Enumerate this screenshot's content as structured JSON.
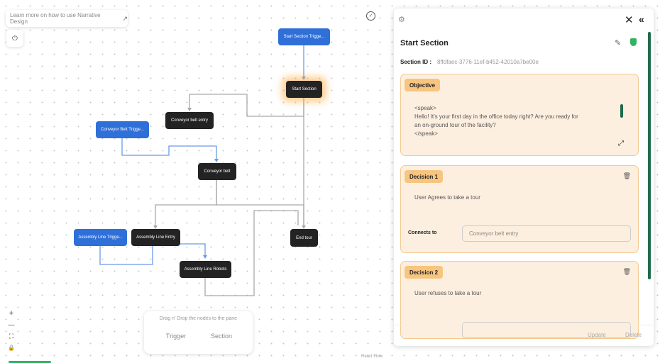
{
  "canvas": {
    "learn_link": "Learn more on how to use Narrative Design",
    "learn_arrow": "↗",
    "power_icon": "⏻",
    "check_icon": "✓",
    "zoom_in": "+",
    "zoom_out": "—",
    "fit": "⛶",
    "lock": "🔒",
    "drag_hint": "Drag n' Drop the nodes to the pane",
    "trigger_label": "Trigger",
    "section_label": "Section",
    "reactflow_label": "React Flow"
  },
  "nodes": [
    {
      "label": "Start Section Trigge...",
      "style": "blue"
    },
    {
      "label": "Start Section",
      "style": "dark"
    },
    {
      "label": "Conveyor belt entry",
      "style": "dark"
    },
    {
      "label": "Conveyor Belt Trigge...",
      "style": "blue"
    },
    {
      "label": "Conveyor belt",
      "style": "dark"
    },
    {
      "label": "Assembly Line Trigge...",
      "style": "blue"
    },
    {
      "label": "Assembly Line Entry",
      "style": "dark"
    },
    {
      "label": "End tour",
      "style": "dark"
    },
    {
      "label": "Assembly Line Robots",
      "style": "dark"
    }
  ],
  "panel": {
    "gear_icon": "⚙",
    "close_icon": "✕",
    "collapse_icon": "«",
    "title": "Start Section",
    "edit_icon": "✎",
    "section_id_label": "Section ID :",
    "section_id_value": "8ffdfaec-3776-11ef-b452-42010a7be00e",
    "objective": {
      "tag": "Objective",
      "text": "<speak>\nHello! It's your first day in the office today right? Are you ready for\nan on-ground tour of the facility?\n</speak>",
      "expand_icon": "⤢"
    },
    "decisions": [
      {
        "tag": "Decision 1",
        "text": "User Agrees to take a tour",
        "connects_label": "Connects to",
        "connects_value": "Conveyor belt entry"
      },
      {
        "tag": "Decision 2",
        "text": "User refuses to take a tour"
      }
    ],
    "trash_icon": "🗑",
    "update_label": "Update",
    "delete_label": "Delete"
  },
  "colors": {
    "accent_blue": "#2f6fd8",
    "node_dark": "#232323",
    "card_bg": "#fdefdf",
    "card_tag": "#f7c57f",
    "green": "#2db562"
  }
}
